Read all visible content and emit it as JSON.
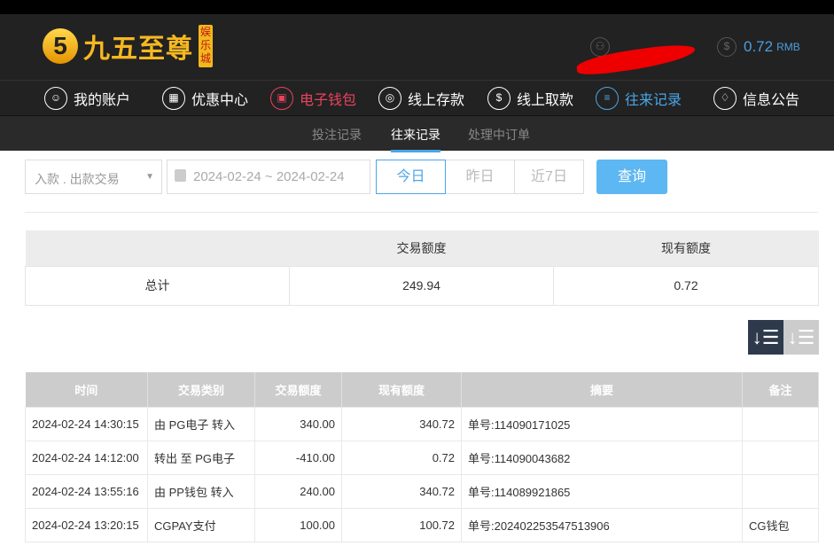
{
  "header": {
    "logo_text": "九五至尊",
    "logo_badge": "娱乐城",
    "logo_mark": "5",
    "balance": "0.72",
    "currency": "RMB"
  },
  "nav": [
    {
      "label": "我的账户",
      "icon": "user-icon"
    },
    {
      "label": "优惠中心",
      "icon": "gift-icon"
    },
    {
      "label": "电子钱包",
      "icon": "wallet-icon"
    },
    {
      "label": "线上存款",
      "icon": "deposit-icon"
    },
    {
      "label": "线上取款",
      "icon": "withdraw-icon"
    },
    {
      "label": "往来记录",
      "icon": "records-icon"
    },
    {
      "label": "信息公告",
      "icon": "bell-icon"
    }
  ],
  "subnav": [
    "投注记录",
    "往来记录",
    "处理中订单"
  ],
  "filter": {
    "type": "入款 . 出款交易",
    "date_range": "2024-02-24 ~ 2024-02-24",
    "tabs": [
      "今日",
      "昨日",
      "近7日"
    ],
    "query": "查询"
  },
  "summary": {
    "headers": [
      "",
      "交易额度",
      "现有额度"
    ],
    "row": [
      "总计",
      "249.94",
      "0.72"
    ]
  },
  "table": {
    "headers": [
      "时间",
      "交易类别",
      "交易额度",
      "现有额度",
      "摘要",
      "备注"
    ],
    "rows": [
      [
        "2024-02-24 14:30:15",
        "由 PG电子 转入",
        "340.00",
        "340.72",
        "单号:114090171025",
        ""
      ],
      [
        "2024-02-24 14:12:00",
        "转出 至 PG电子",
        "-410.00",
        "0.72",
        "单号:114090043682",
        ""
      ],
      [
        "2024-02-24 13:55:16",
        "由 PP钱包 转入",
        "240.00",
        "340.72",
        "单号:114089921865",
        ""
      ],
      [
        "2024-02-24 13:20:15",
        "CGPAY支付",
        "100.00",
        "100.72",
        "单号:202402253547513906",
        "CG钱包"
      ]
    ]
  },
  "colors": {
    "active_red": "#e8435d",
    "active_blue": "#4aa6e8",
    "button": "#5db7f2"
  }
}
